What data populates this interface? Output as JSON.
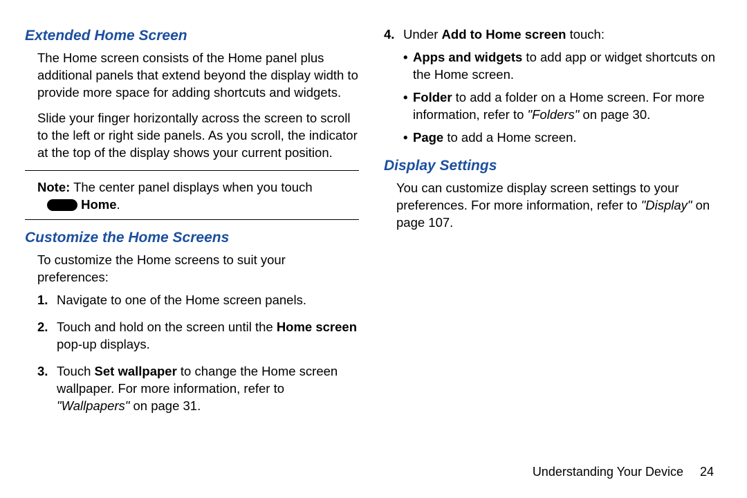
{
  "left": {
    "heading1": "Extended Home Screen",
    "p1": "The Home screen consists of the Home panel plus additional panels that extend beyond the display width to provide more space for adding shortcuts and widgets.",
    "p2": "Slide your finger horizontally across the screen to scroll to the left or right side panels. As you scroll, the indicator at the top of the display shows your current position.",
    "note_label": "Note:",
    "note_text": " The center panel displays when you touch ",
    "home_label": " Home",
    "note_period": ".",
    "heading2": "Customize the Home Screens",
    "intro": "To customize the Home screens to suit your preferences:",
    "step1": "Navigate to one of the Home screen panels.",
    "step2a": "Touch and hold on the screen until the ",
    "step2b": "Home screen",
    "step2c": " pop-up displays.",
    "step3a": "Touch ",
    "step3b": "Set wallpaper",
    "step3c": " to change the Home screen wallpaper. For more information, refer to ",
    "step3d": "\"Wallpapers\"",
    "step3e": " on page 31."
  },
  "right": {
    "step4a": "Under ",
    "step4b": "Add to Home screen",
    "step4c": " touch:",
    "b1a": "Apps and widgets",
    "b1b": " to add app or widget shortcuts on the Home screen.",
    "b2a": "Folder",
    "b2b": " to add a folder on a Home screen. For more information, refer to ",
    "b2c": "\"Folders\"",
    "b2d": " on page 30.",
    "b3a": "Page",
    "b3b": " to add a Home screen.",
    "heading3": "Display Settings",
    "dp1a": "You can customize display screen settings to your preferences. For more information, refer to ",
    "dp1b": "\"Display\"",
    "dp1c": " on page 107."
  },
  "footer": {
    "section": "Understanding Your Device",
    "page": "24"
  }
}
